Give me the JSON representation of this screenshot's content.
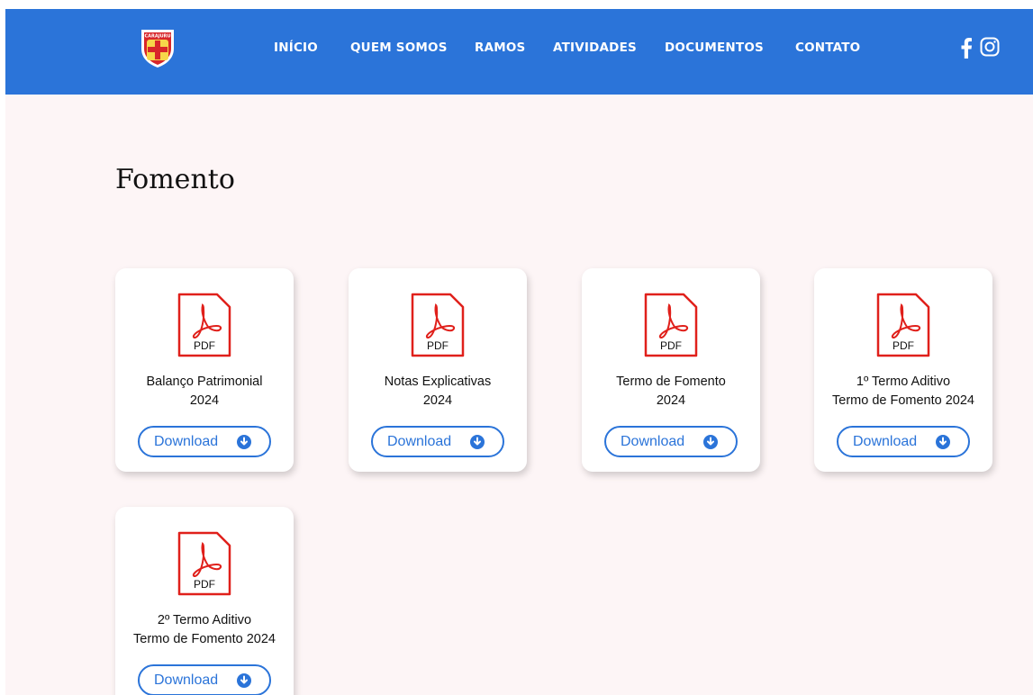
{
  "header": {
    "logo_text": "CARAJURU",
    "nav": [
      {
        "label": "INÍCIO"
      },
      {
        "label": "QUEM SOMOS"
      },
      {
        "label": "RAMOS"
      },
      {
        "label": "ATIVIDADES"
      },
      {
        "label": "DOCUMENTOS"
      },
      {
        "label": "CONTATO"
      }
    ],
    "social": [
      "facebook-icon",
      "instagram-icon"
    ],
    "color": "#2b74d9"
  },
  "page": {
    "title": "Fomento"
  },
  "documents": [
    {
      "icon_label": "PDF",
      "title_line1": "Balanço Patrimonial",
      "title_line2": "2024",
      "button_label": "Download"
    },
    {
      "icon_label": "PDF",
      "title_line1": "Notas Explicativas",
      "title_line2": "2024",
      "button_label": "Download"
    },
    {
      "icon_label": "PDF",
      "title_line1": "Termo de Fomento",
      "title_line2": "2024",
      "button_label": "Download"
    },
    {
      "icon_label": "PDF",
      "title_line1": "1º Termo Aditivo",
      "title_line2": "Termo de Fomento 2024",
      "button_label": "Download"
    },
    {
      "icon_label": "PDF",
      "title_line1": "2º Termo Aditivo",
      "title_line2": "Termo de Fomento 2024",
      "button_label": "Download"
    }
  ],
  "colors": {
    "accent": "#2b74d9",
    "pdf_red": "#e0201b",
    "background": "#fdf5f6"
  }
}
